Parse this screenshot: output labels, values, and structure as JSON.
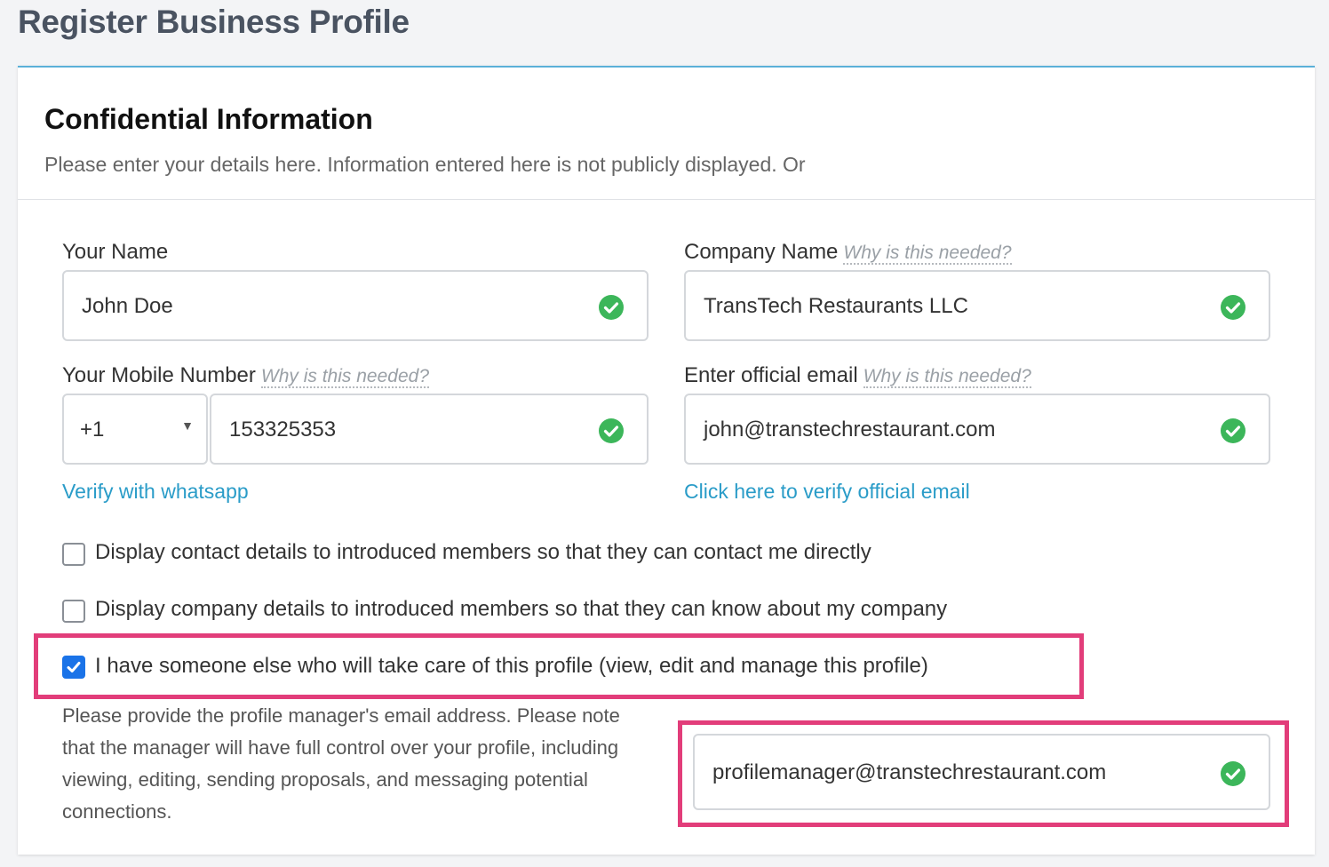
{
  "page": {
    "title": "Register Business Profile"
  },
  "section": {
    "title": "Confidential Information",
    "subtitle": "Please enter your details here. Information entered here is not publicly displayed. Or"
  },
  "fields": {
    "your_name": {
      "label": "Your Name",
      "value": "John Doe"
    },
    "company_name": {
      "label": "Company Name",
      "why": "Why is this needed?",
      "value": "TransTech Restaurants LLC"
    },
    "mobile": {
      "label": "Your Mobile Number",
      "why": "Why is this needed?",
      "country_code": "+1",
      "value": "153325353",
      "verify_link": "Verify with whatsapp"
    },
    "email": {
      "label": "Enter official email",
      "why": "Why is this needed?",
      "value": "john@transtechrestaurant.com",
      "verify_link": "Click here to verify official email"
    }
  },
  "options": {
    "display_contact": {
      "label": "Display contact details to introduced members so that they can contact me directly",
      "checked": false
    },
    "display_company": {
      "label": "Display company details to introduced members so that they can know about my company",
      "checked": false
    },
    "profile_manager": {
      "label": "I have someone else who will take care of this profile (view, edit and manage this profile)",
      "checked": true
    }
  },
  "manager": {
    "note": "Please provide the profile manager's email address. Please note that the manager will have full control over your profile, including viewing, editing, sending proposals, and messaging potential connections.",
    "email": "profilemanager@transtechrestaurant.com"
  },
  "colors": {
    "accent_link": "#2a9cc8",
    "valid_check": "#3cb65a",
    "highlight": "#e23d7a",
    "checkbox_checked": "#1a73e8",
    "card_top_border": "#5bb0d8"
  },
  "icons": {
    "valid": "check-circle-icon",
    "dropdown": "chevron-down-icon",
    "checkbox_mark": "checkmark-icon"
  }
}
